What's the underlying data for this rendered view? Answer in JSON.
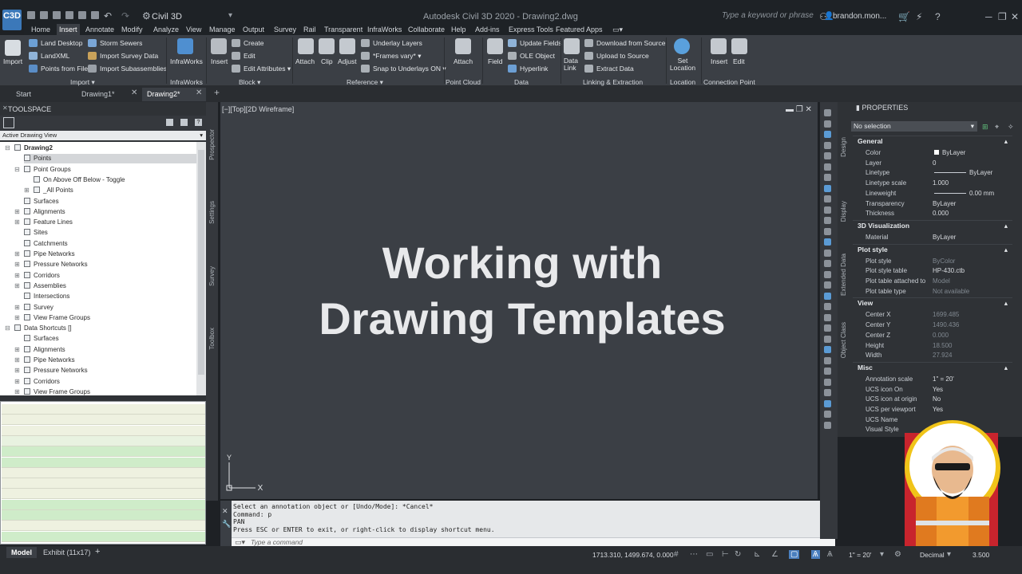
{
  "app": {
    "logo": "C3D",
    "workspace": "Civil 3D",
    "title": "Autodesk Civil 3D 2020 - Drawing2.dwg",
    "search_placeholder": "Type a keyword or phrase",
    "user": "brandon.mon..."
  },
  "ribbon_tabs": [
    "Home",
    "Insert",
    "Annotate",
    "Modify",
    "Analyze",
    "View",
    "Manage",
    "Output",
    "Survey",
    "Rail",
    "Transparent",
    "InfraWorks",
    "Collaborate",
    "Help",
    "Add-ins",
    "Express Tools",
    "Featured Apps"
  ],
  "active_ribbon_tab": "Insert",
  "ribbon": {
    "import": {
      "big": "Import",
      "items": [
        "Land Desktop",
        "LandXML",
        "Points from File",
        "Storm Sewers",
        "Import Survey Data",
        "Import Subassemblies"
      ],
      "label": "Import"
    },
    "infraworks": {
      "big": "InfraWorks",
      "label": "InfraWorks"
    },
    "block": {
      "big": "Insert",
      "items": [
        "Create",
        "Edit",
        "Edit Attributes"
      ],
      "label": "Block"
    },
    "reference": {
      "bigs": [
        "Attach",
        "Clip",
        "Adjust"
      ],
      "items": [
        "Underlay Layers",
        "*Frames vary*",
        "Snap to Underlays ON"
      ],
      "label": "Reference"
    },
    "pointcloud": {
      "big": "Attach",
      "label": "Point Cloud"
    },
    "data": {
      "big": "Field",
      "items": [
        "Update Fields",
        "OLE Object",
        "Hyperlink"
      ],
      "label": "Data"
    },
    "linking": {
      "big": "Data Link",
      "items": [
        "Download from Source",
        "Upload to Source",
        "Extract Data"
      ],
      "label": "Linking & Extraction"
    },
    "location": {
      "big": "Set Location",
      "label": "Location"
    },
    "connection": {
      "bigs": [
        "Insert",
        "Edit"
      ],
      "label": "Connection Point"
    }
  },
  "doc_tabs": [
    "Start",
    "Drawing1*",
    "Drawing2*"
  ],
  "active_doc_tab": "Drawing2*",
  "toolspace": {
    "title": "TOOLSPACE",
    "view_select": "Active Drawing View",
    "tree": [
      {
        "label": "Drawing2",
        "level": 0,
        "bold": true
      },
      {
        "label": "Points",
        "level": 1,
        "selected": true
      },
      {
        "label": "Point Groups",
        "level": 1
      },
      {
        "label": "On Above Off Below - Toggle",
        "level": 2
      },
      {
        "label": "_All Points",
        "level": 2
      },
      {
        "label": "Surfaces",
        "level": 1
      },
      {
        "label": "Alignments",
        "level": 1
      },
      {
        "label": "Feature Lines",
        "level": 1
      },
      {
        "label": "Sites",
        "level": 1
      },
      {
        "label": "Catchments",
        "level": 1
      },
      {
        "label": "Pipe Networks",
        "level": 1
      },
      {
        "label": "Pressure Networks",
        "level": 1
      },
      {
        "label": "Corridors",
        "level": 1
      },
      {
        "label": "Assemblies",
        "level": 1
      },
      {
        "label": "Intersections",
        "level": 1
      },
      {
        "label": "Survey",
        "level": 1
      },
      {
        "label": "View Frame Groups",
        "level": 1
      },
      {
        "label": "Data Shortcuts []",
        "level": 0
      },
      {
        "label": "Surfaces",
        "level": 1
      },
      {
        "label": "Alignments",
        "level": 1
      },
      {
        "label": "Pipe Networks",
        "level": 1
      },
      {
        "label": "Pressure Networks",
        "level": 1
      },
      {
        "label": "Corridors",
        "level": 1
      },
      {
        "label": "View Frame Groups",
        "level": 1
      }
    ],
    "side_tabs": [
      "Prospector",
      "Settings",
      "Survey",
      "Toolbox"
    ]
  },
  "viewport": {
    "label": "[−][Top][2D Wireframe]",
    "title_line1": "Working with",
    "title_line2": "Drawing Templates",
    "ucs_x": "X",
    "ucs_y": "Y"
  },
  "command": {
    "history": [
      "Select an annotation object or [Undo/Mode]: *Cancel*",
      "Command: p",
      "PAN",
      "Press ESC or ENTER to exit, or right-click to display shortcut menu."
    ],
    "placeholder": "Type a command"
  },
  "properties": {
    "title": "PROPERTIES",
    "selection": "No selection",
    "side_tabs": [
      "Design",
      "Display",
      "Extended Data",
      "Object Class"
    ],
    "sections": [
      {
        "name": "General",
        "rows": [
          [
            "Color",
            "ByLayer"
          ],
          [
            "Layer",
            "0"
          ],
          [
            "Linetype",
            "ByLayer"
          ],
          [
            "Linetype scale",
            "1.000"
          ],
          [
            "Lineweight",
            "0.00 mm"
          ],
          [
            "Transparency",
            "ByLayer"
          ],
          [
            "Thickness",
            "0.000"
          ]
        ]
      },
      {
        "name": "3D Visualization",
        "rows": [
          [
            "Material",
            "ByLayer"
          ]
        ]
      },
      {
        "name": "Plot style",
        "rows": [
          [
            "Plot style",
            "ByColor"
          ],
          [
            "Plot style table",
            "HP-430.ctb"
          ],
          [
            "Plot table attached to",
            "Model"
          ],
          [
            "Plot table type",
            "Not available"
          ]
        ]
      },
      {
        "name": "View",
        "rows": [
          [
            "Center X",
            "1699.485"
          ],
          [
            "Center Y",
            "1490.436"
          ],
          [
            "Center Z",
            "0.000"
          ],
          [
            "Height",
            "18.500"
          ],
          [
            "Width",
            "27.924"
          ]
        ]
      },
      {
        "name": "Misc",
        "rows": [
          [
            "Annotation scale",
            "1\" = 20'"
          ],
          [
            "UCS icon On",
            "Yes"
          ],
          [
            "UCS icon at origin",
            "No"
          ],
          [
            "UCS per viewport",
            "Yes"
          ],
          [
            "UCS Name",
            ""
          ],
          [
            "Visual Style",
            "2D Wireframe"
          ]
        ]
      }
    ]
  },
  "status": {
    "tabs": [
      "Model",
      "Exhibit (11x17)"
    ],
    "coords": "1713.310, 1499.674, 0.000",
    "scale": "1\" = 20'",
    "units": "Decimal",
    "value": "3.500"
  }
}
